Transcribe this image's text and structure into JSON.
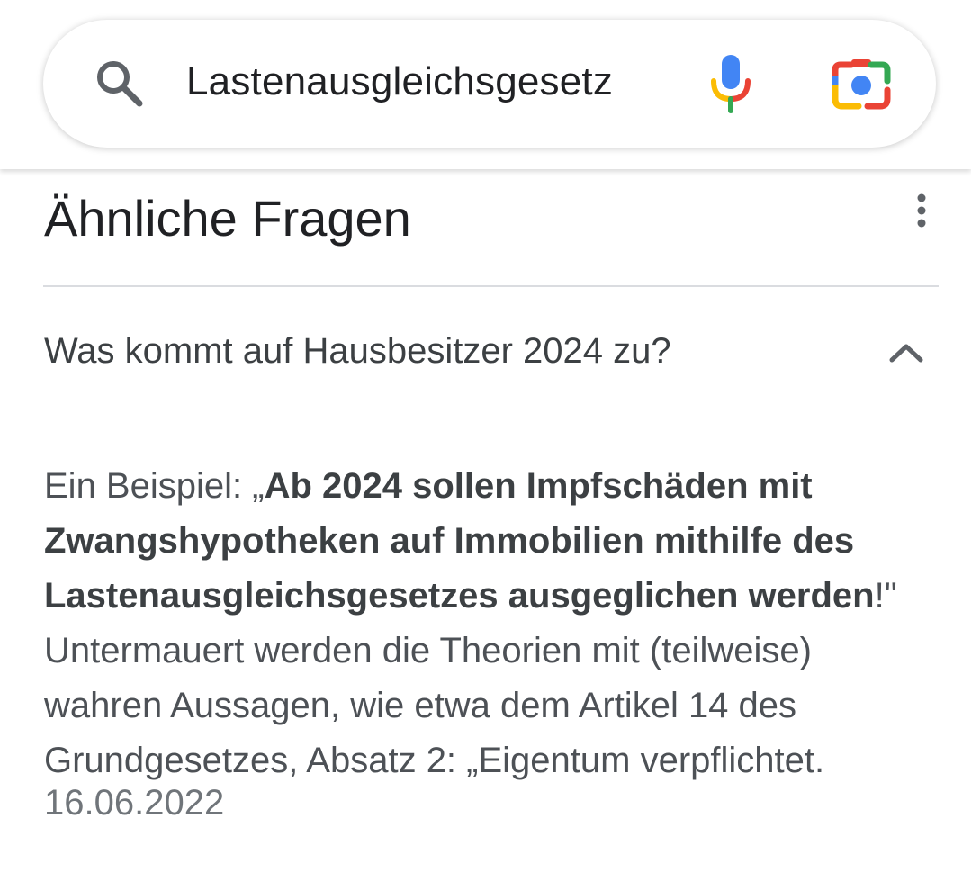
{
  "search": {
    "query": "Lastenausgleichsgesetz",
    "icons": {
      "search": "search-icon",
      "voice": "mic-icon",
      "lens": "camera-lens-icon"
    }
  },
  "section": {
    "title": "Ähnliche Fragen",
    "menu_icon": "more-vert-icon"
  },
  "question": {
    "text": "Was kommt auf Hausbesitzer 2024 zu?",
    "expanded": true,
    "chevron_icon": "chevron-up-icon"
  },
  "answer": {
    "prefix": "Ein Beispiel: „",
    "bold": "Ab 2024 sollen Impfschäden mit Zwangshypotheken auf Immobilien mithilfe des Lastenausgleichsgesetzes ausgeglichen werden",
    "suffix": "!\" Untermauert werden die Theorien mit (teilweise) wahren Aussagen, wie etwa dem Artikel 14 des Grundgesetzes, Absatz 2: „Eigentum verpflichtet.",
    "date": "16.06.2022"
  },
  "colors": {
    "mic_blue": "#4285F4",
    "mic_green": "#34A853",
    "mic_yellow": "#FBBC04",
    "mic_red": "#EA4335",
    "text_dark": "#202124",
    "text_body": "#4d5156",
    "divider": "#dadce0"
  }
}
